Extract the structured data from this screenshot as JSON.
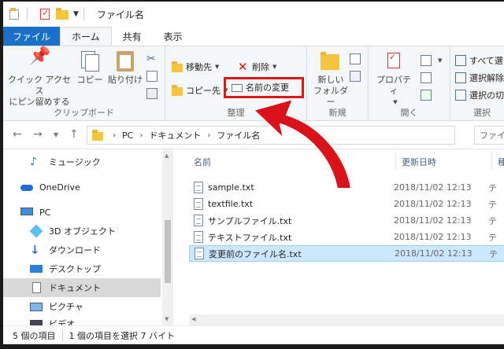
{
  "window": {
    "title": "ファイル名"
  },
  "tabs": [
    "ファイル",
    "ホーム",
    "共有",
    "表示"
  ],
  "ribbon": {
    "clipboard": {
      "pin_label": "クイック アクセス\nにピン留めする",
      "copy": "コピー",
      "paste": "貼り付け",
      "label": "クリップボード"
    },
    "organize": {
      "move_to": "移動先",
      "copy_to": "コピー先",
      "delete": "削除",
      "rename": "名前の変更",
      "label": "整理"
    },
    "new": {
      "new_folder": "新しい\nフォルダー",
      "label": "新規"
    },
    "open": {
      "properties": "プロパティ",
      "label": "開く"
    },
    "select": {
      "select_all": "すべて選",
      "select_none": "選択解除",
      "invert": "選択の切",
      "label": "選択"
    }
  },
  "address": {
    "crumbs": [
      "PC",
      "ドキュメント",
      "ファイル名"
    ],
    "search_placeholder": "ファイ"
  },
  "nav": [
    {
      "label": "ミュージック",
      "icon": "music-icon"
    },
    {
      "label": "OneDrive",
      "icon": "onedrive-icon"
    },
    {
      "label": "PC",
      "icon": "pc-icon"
    },
    {
      "label": "3D オブジェクト",
      "icon": "3d-objects-icon"
    },
    {
      "label": "ダウンロード",
      "icon": "download-icon"
    },
    {
      "label": "デスクトップ",
      "icon": "desktop-icon"
    },
    {
      "label": "ドキュメント",
      "icon": "documents-icon"
    },
    {
      "label": "ピクチャ",
      "icon": "pictures-icon"
    },
    {
      "label": "ビデオ",
      "icon": "videos-icon"
    }
  ],
  "columns": {
    "name": "名前",
    "date": "更新日時",
    "type": "種"
  },
  "files": [
    {
      "name": "sample.txt",
      "date": "2018/11/02 12:13",
      "type": "テ"
    },
    {
      "name": "textfile.txt",
      "date": "2018/11/02 12:13",
      "type": "テ"
    },
    {
      "name": "サンプルファイル.txt",
      "date": "2018/11/02 12:13",
      "type": "テ"
    },
    {
      "name": "テキストファイル.txt",
      "date": "2018/11/02 12:13",
      "type": "テ"
    },
    {
      "name": "変更前のファイル名.txt",
      "date": "2018/11/02 12:13",
      "type": "テ"
    }
  ],
  "status": {
    "count": "5 個の項目",
    "selected": "1 個の項目を選択 7 バイト"
  },
  "colors": {
    "accent": "#1a6fc7",
    "highlight": "#e0151a",
    "selection": "#cce8ff"
  }
}
